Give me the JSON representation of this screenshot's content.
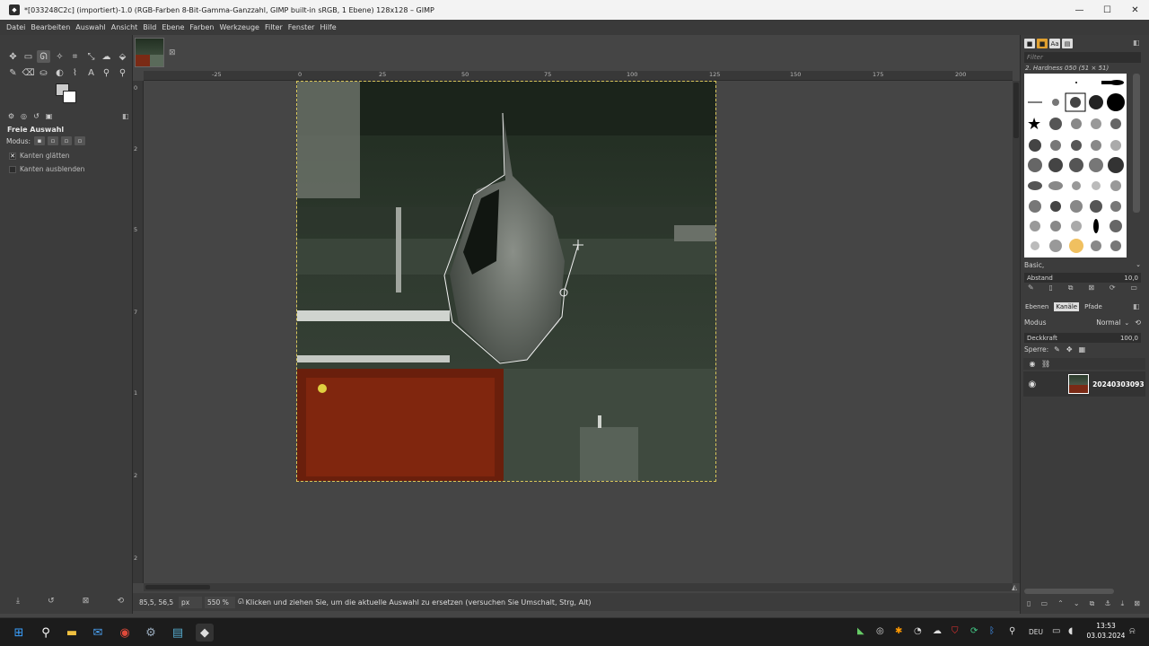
{
  "window": {
    "title": "*[033248C2c] (importiert)-1.0 (RGB-Farben 8-Bit-Gamma-Ganzzahl, GIMP built-in sRGB, 1 Ebene) 128x128 – GIMP",
    "app_icon": "gimp-icon",
    "minimize": "—",
    "maximize": "☐",
    "close": "✕"
  },
  "menu": [
    "Datei",
    "Bearbeiten",
    "Auswahl",
    "Ansicht",
    "Bild",
    "Ebene",
    "Farben",
    "Werkzeuge",
    "Filter",
    "Fenster",
    "Hilfe"
  ],
  "toolbox": {
    "tools_row1": [
      "move-tool-icon",
      "rect-select-icon",
      "free-select-icon",
      "fuzzy-select-icon",
      "crop-icon",
      "unified-transform-icon",
      "warp-icon",
      "fill-icon"
    ],
    "tools_row2": [
      "paintbrush-icon",
      "eraser-icon",
      "clone-icon",
      "dodge-icon",
      "path-icon",
      "text-icon",
      "color-picker-icon",
      "zoom-icon"
    ],
    "tool_options": {
      "title": "Freie Auswahl",
      "mode_label": "Modus:",
      "antialias_label": "Kanten glätten",
      "feather_label": "Kanten ausblenden"
    }
  },
  "ruler": {
    "h_ticks": [
      "-25",
      "0",
      "25",
      "50",
      "75",
      "100",
      "125",
      "150",
      "175",
      "200"
    ],
    "v_ticks": [
      "0",
      "2",
      "5",
      "7",
      "1",
      "2",
      "2"
    ]
  },
  "status": {
    "coords": "85,5, 56,5",
    "unit": "px",
    "zoom": "550 %",
    "message": "Klicken und ziehen Sie, um die aktuelle Auswahl zu ersetzen (versuchen Sie Umschalt, Strg, Alt)"
  },
  "brushes": {
    "filter_placeholder": "Filter",
    "selected_name": "2. Hardness 050 (51 × 51)",
    "preset": "Basic,",
    "spacing_label": "Abstand",
    "spacing_value": "10,0"
  },
  "layers": {
    "tabs": [
      "Ebenen",
      "Kanäle",
      "Pfade"
    ],
    "mode_label": "Modus",
    "mode_value": "Normal",
    "opacity_label": "Deckkraft",
    "opacity_value": "100,0",
    "lock_label": "Sperre:",
    "layer_name": "20240303093"
  },
  "taskbar": {
    "language": "DEU",
    "time": "13:53",
    "date": "03.03.2024"
  }
}
